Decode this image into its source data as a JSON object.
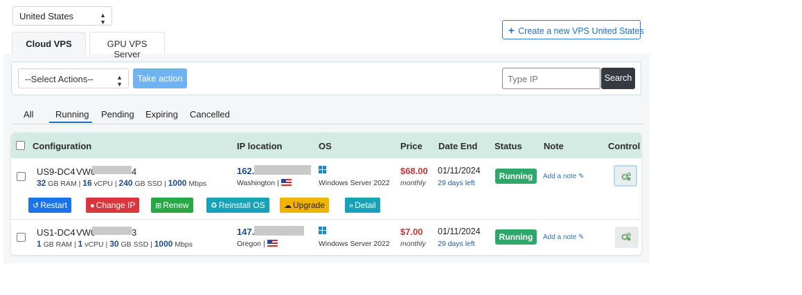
{
  "country_select": {
    "value": "United States"
  },
  "top_tabs": [
    {
      "label": "Cloud VPS"
    },
    {
      "label": "GPU VPS Server"
    }
  ],
  "create_button": {
    "label": "Create a new VPS United States"
  },
  "filters": {
    "actions_select": "--Select Actions--",
    "take_action": "Take action",
    "ip_placeholder": "Type IP",
    "search": "Search"
  },
  "status_tabs": [
    {
      "label": "All"
    },
    {
      "label": "Running"
    },
    {
      "label": "Pending"
    },
    {
      "label": "Expiring"
    },
    {
      "label": "Cancelled"
    }
  ],
  "table": {
    "headers": {
      "configuration": "Configuration",
      "ip_location": "IP location",
      "os": "OS",
      "price": "Price",
      "date_end": "Date End",
      "status": "Status",
      "note": "Note",
      "control": "Control"
    },
    "rows": [
      {
        "location_code": "US9-DC4",
        "name_prefix": "VW0",
        "name_suffix": "4",
        "ram": "32",
        "ram_unit": "GB RAM",
        "cpu": "16",
        "cpu_unit": "vCPU",
        "ssd": "240",
        "ssd_unit": "GB SSD",
        "bw": "1000",
        "bw_unit": "Mbps",
        "ip": "162.2",
        "location": "Washington |",
        "os": "Windows Server 2022",
        "price": "$68.00",
        "period": "monthly",
        "date_end": "01/11/2024",
        "days_left": "29 days left",
        "status": "Running",
        "note": "Add a note"
      },
      {
        "location_code": "US1-DC4",
        "name_prefix": "VW0",
        "name_suffix": "3",
        "ram": "1",
        "ram_unit": "GB RAM",
        "cpu": "1",
        "cpu_unit": "vCPU",
        "ssd": "30",
        "ssd_unit": "GB SSD",
        "bw": "1000",
        "bw_unit": "Mbps",
        "ip": "147.",
        "location": "Oregon |",
        "os": "Windows Server 2022",
        "price": "$7.00",
        "period": "monthly",
        "date_end": "01/11/2024",
        "days_left": "29 days left",
        "status": "Running",
        "note": "Add a note"
      }
    ]
  },
  "row_actions": {
    "restart": "Restart",
    "change_ip": "Change IP",
    "renew": "Renew",
    "reinstall": "Reinstall OS",
    "upgrade": "Upgrade",
    "detail": "Detail"
  },
  "colors": {
    "accent": "#1f6fc9",
    "header_bg": "#d3ebe2",
    "running": "#2ea86a",
    "price": "#c73636",
    "restart": "#1a73e8",
    "change_ip": "#d9363e",
    "renew": "#28a745",
    "reinstall": "#17a2b8",
    "upgrade": "#f0b400",
    "detail": "#17a2b8"
  },
  "icons": [
    "plus-icon",
    "windows-icon",
    "us-flag-icon",
    "edit-icon",
    "gears-icon",
    "restart-icon",
    "pin-icon",
    "plus-square-icon",
    "recycle-icon",
    "cloud-upload-icon",
    "double-chevron-icon"
  ]
}
